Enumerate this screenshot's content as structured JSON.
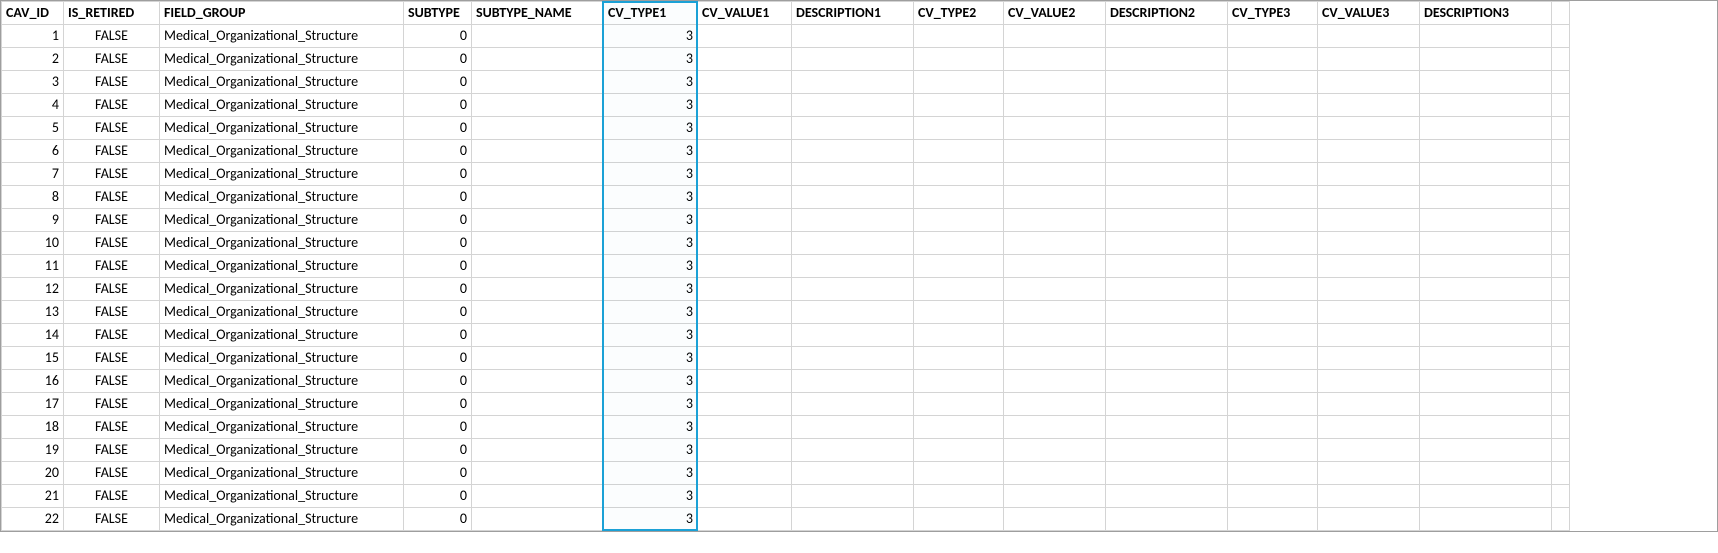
{
  "headers": {
    "cav_id": "CAV_ID",
    "is_retired": "IS_RETIRED",
    "field_group": "FIELD_GROUP",
    "subtype": "SUBTYPE",
    "subtype_name": "SUBTYPE_NAME",
    "cv_type1": "CV_TYPE1",
    "cv_value1": "CV_VALUE1",
    "description1": "DESCRIPTION1",
    "cv_type2": "CV_TYPE2",
    "cv_value2": "CV_VALUE2",
    "description2": "DESCRIPTION2",
    "cv_type3": "CV_TYPE3",
    "cv_value3": "CV_VALUE3",
    "description3": "DESCRIPTION3"
  },
  "rows": [
    {
      "cav_id": "1",
      "is_retired": "FALSE",
      "field_group": "Medical_Organizational_Structure",
      "subtype": "0",
      "subtype_name": "",
      "cv_type1": "3",
      "cv_value1": "",
      "description1": "",
      "cv_type2": "",
      "cv_value2": "",
      "description2": "",
      "cv_type3": "",
      "cv_value3": "",
      "description3": ""
    },
    {
      "cav_id": "2",
      "is_retired": "FALSE",
      "field_group": "Medical_Organizational_Structure",
      "subtype": "0",
      "subtype_name": "",
      "cv_type1": "3",
      "cv_value1": "",
      "description1": "",
      "cv_type2": "",
      "cv_value2": "",
      "description2": "",
      "cv_type3": "",
      "cv_value3": "",
      "description3": ""
    },
    {
      "cav_id": "3",
      "is_retired": "FALSE",
      "field_group": "Medical_Organizational_Structure",
      "subtype": "0",
      "subtype_name": "",
      "cv_type1": "3",
      "cv_value1": "",
      "description1": "",
      "cv_type2": "",
      "cv_value2": "",
      "description2": "",
      "cv_type3": "",
      "cv_value3": "",
      "description3": ""
    },
    {
      "cav_id": "4",
      "is_retired": "FALSE",
      "field_group": "Medical_Organizational_Structure",
      "subtype": "0",
      "subtype_name": "",
      "cv_type1": "3",
      "cv_value1": "",
      "description1": "",
      "cv_type2": "",
      "cv_value2": "",
      "description2": "",
      "cv_type3": "",
      "cv_value3": "",
      "description3": ""
    },
    {
      "cav_id": "5",
      "is_retired": "FALSE",
      "field_group": "Medical_Organizational_Structure",
      "subtype": "0",
      "subtype_name": "",
      "cv_type1": "3",
      "cv_value1": "",
      "description1": "",
      "cv_type2": "",
      "cv_value2": "",
      "description2": "",
      "cv_type3": "",
      "cv_value3": "",
      "description3": ""
    },
    {
      "cav_id": "6",
      "is_retired": "FALSE",
      "field_group": "Medical_Organizational_Structure",
      "subtype": "0",
      "subtype_name": "",
      "cv_type1": "3",
      "cv_value1": "",
      "description1": "",
      "cv_type2": "",
      "cv_value2": "",
      "description2": "",
      "cv_type3": "",
      "cv_value3": "",
      "description3": ""
    },
    {
      "cav_id": "7",
      "is_retired": "FALSE",
      "field_group": "Medical_Organizational_Structure",
      "subtype": "0",
      "subtype_name": "",
      "cv_type1": "3",
      "cv_value1": "",
      "description1": "",
      "cv_type2": "",
      "cv_value2": "",
      "description2": "",
      "cv_type3": "",
      "cv_value3": "",
      "description3": ""
    },
    {
      "cav_id": "8",
      "is_retired": "FALSE",
      "field_group": "Medical_Organizational_Structure",
      "subtype": "0",
      "subtype_name": "",
      "cv_type1": "3",
      "cv_value1": "",
      "description1": "",
      "cv_type2": "",
      "cv_value2": "",
      "description2": "",
      "cv_type3": "",
      "cv_value3": "",
      "description3": ""
    },
    {
      "cav_id": "9",
      "is_retired": "FALSE",
      "field_group": "Medical_Organizational_Structure",
      "subtype": "0",
      "subtype_name": "",
      "cv_type1": "3",
      "cv_value1": "",
      "description1": "",
      "cv_type2": "",
      "cv_value2": "",
      "description2": "",
      "cv_type3": "",
      "cv_value3": "",
      "description3": ""
    },
    {
      "cav_id": "10",
      "is_retired": "FALSE",
      "field_group": "Medical_Organizational_Structure",
      "subtype": "0",
      "subtype_name": "",
      "cv_type1": "3",
      "cv_value1": "",
      "description1": "",
      "cv_type2": "",
      "cv_value2": "",
      "description2": "",
      "cv_type3": "",
      "cv_value3": "",
      "description3": ""
    },
    {
      "cav_id": "11",
      "is_retired": "FALSE",
      "field_group": "Medical_Organizational_Structure",
      "subtype": "0",
      "subtype_name": "",
      "cv_type1": "3",
      "cv_value1": "",
      "description1": "",
      "cv_type2": "",
      "cv_value2": "",
      "description2": "",
      "cv_type3": "",
      "cv_value3": "",
      "description3": ""
    },
    {
      "cav_id": "12",
      "is_retired": "FALSE",
      "field_group": "Medical_Organizational_Structure",
      "subtype": "0",
      "subtype_name": "",
      "cv_type1": "3",
      "cv_value1": "",
      "description1": "",
      "cv_type2": "",
      "cv_value2": "",
      "description2": "",
      "cv_type3": "",
      "cv_value3": "",
      "description3": ""
    },
    {
      "cav_id": "13",
      "is_retired": "FALSE",
      "field_group": "Medical_Organizational_Structure",
      "subtype": "0",
      "subtype_name": "",
      "cv_type1": "3",
      "cv_value1": "",
      "description1": "",
      "cv_type2": "",
      "cv_value2": "",
      "description2": "",
      "cv_type3": "",
      "cv_value3": "",
      "description3": ""
    },
    {
      "cav_id": "14",
      "is_retired": "FALSE",
      "field_group": "Medical_Organizational_Structure",
      "subtype": "0",
      "subtype_name": "",
      "cv_type1": "3",
      "cv_value1": "",
      "description1": "",
      "cv_type2": "",
      "cv_value2": "",
      "description2": "",
      "cv_type3": "",
      "cv_value3": "",
      "description3": ""
    },
    {
      "cav_id": "15",
      "is_retired": "FALSE",
      "field_group": "Medical_Organizational_Structure",
      "subtype": "0",
      "subtype_name": "",
      "cv_type1": "3",
      "cv_value1": "",
      "description1": "",
      "cv_type2": "",
      "cv_value2": "",
      "description2": "",
      "cv_type3": "",
      "cv_value3": "",
      "description3": ""
    },
    {
      "cav_id": "16",
      "is_retired": "FALSE",
      "field_group": "Medical_Organizational_Structure",
      "subtype": "0",
      "subtype_name": "",
      "cv_type1": "3",
      "cv_value1": "",
      "description1": "",
      "cv_type2": "",
      "cv_value2": "",
      "description2": "",
      "cv_type3": "",
      "cv_value3": "",
      "description3": ""
    },
    {
      "cav_id": "17",
      "is_retired": "FALSE",
      "field_group": "Medical_Organizational_Structure",
      "subtype": "0",
      "subtype_name": "",
      "cv_type1": "3",
      "cv_value1": "",
      "description1": "",
      "cv_type2": "",
      "cv_value2": "",
      "description2": "",
      "cv_type3": "",
      "cv_value3": "",
      "description3": ""
    },
    {
      "cav_id": "18",
      "is_retired": "FALSE",
      "field_group": "Medical_Organizational_Structure",
      "subtype": "0",
      "subtype_name": "",
      "cv_type1": "3",
      "cv_value1": "",
      "description1": "",
      "cv_type2": "",
      "cv_value2": "",
      "description2": "",
      "cv_type3": "",
      "cv_value3": "",
      "description3": ""
    },
    {
      "cav_id": "19",
      "is_retired": "FALSE",
      "field_group": "Medical_Organizational_Structure",
      "subtype": "0",
      "subtype_name": "",
      "cv_type1": "3",
      "cv_value1": "",
      "description1": "",
      "cv_type2": "",
      "cv_value2": "",
      "description2": "",
      "cv_type3": "",
      "cv_value3": "",
      "description3": ""
    },
    {
      "cav_id": "20",
      "is_retired": "FALSE",
      "field_group": "Medical_Organizational_Structure",
      "subtype": "0",
      "subtype_name": "",
      "cv_type1": "3",
      "cv_value1": "",
      "description1": "",
      "cv_type2": "",
      "cv_value2": "",
      "description2": "",
      "cv_type3": "",
      "cv_value3": "",
      "description3": ""
    },
    {
      "cav_id": "21",
      "is_retired": "FALSE",
      "field_group": "Medical_Organizational_Structure",
      "subtype": "0",
      "subtype_name": "",
      "cv_type1": "3",
      "cv_value1": "",
      "description1": "",
      "cv_type2": "",
      "cv_value2": "",
      "description2": "",
      "cv_type3": "",
      "cv_value3": "",
      "description3": ""
    },
    {
      "cav_id": "22",
      "is_retired": "FALSE",
      "field_group": "Medical_Organizational_Structure",
      "subtype": "0",
      "subtype_name": "",
      "cv_type1": "3",
      "cv_value1": "",
      "description1": "",
      "cv_type2": "",
      "cv_value2": "",
      "description2": "",
      "cv_type3": "",
      "cv_value3": "",
      "description3": ""
    }
  ],
  "selected_column": "cv_type1"
}
